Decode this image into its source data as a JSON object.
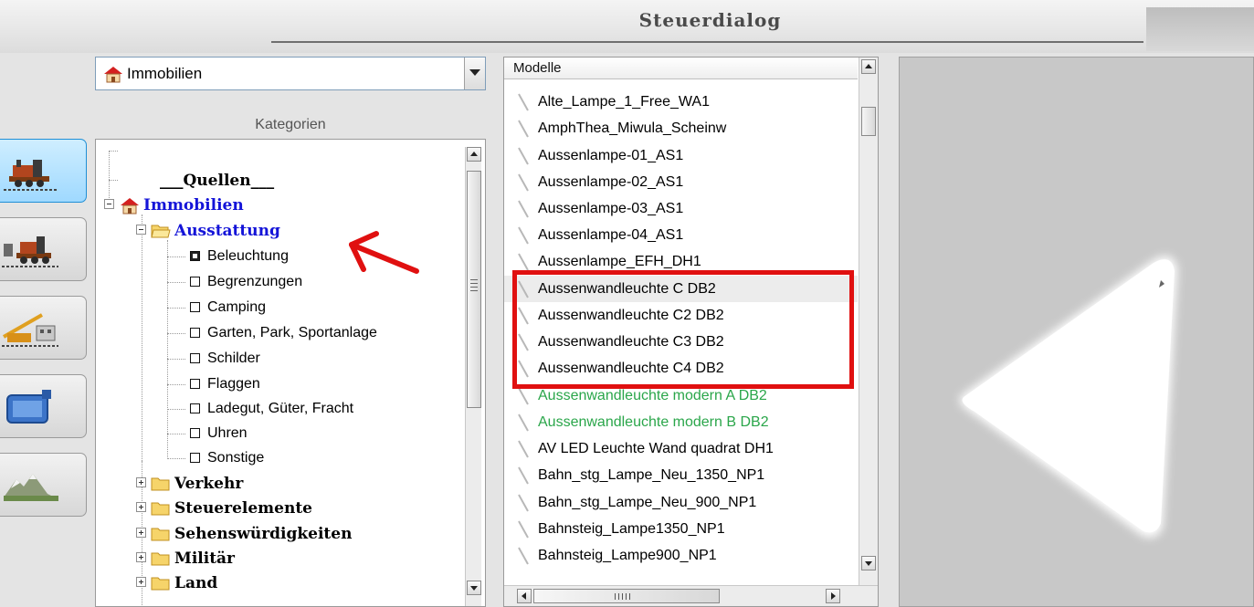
{
  "window": {
    "title": "Steuerdialog"
  },
  "toolbar": {
    "buttons": [
      {
        "icon": "locomotive-icon",
        "active": true
      },
      {
        "icon": "train-set-icon",
        "active": false
      },
      {
        "icon": "crane-icon",
        "active": false
      },
      {
        "icon": "camera-icon",
        "active": false
      },
      {
        "icon": "landscape-icon",
        "active": false
      }
    ]
  },
  "category_select": {
    "value": "Immobilien",
    "icon": "house-icon"
  },
  "categories": {
    "label": "Kategorien",
    "tree": [
      {
        "label": "___Quellen___",
        "style": "bold"
      },
      {
        "label": "Immobilien",
        "style": "bold-blue",
        "expanded": true,
        "icon": "house-icon"
      },
      {
        "label": "Ausstattung",
        "style": "bold-blue",
        "expanded": true,
        "icon": "folder-open-icon"
      },
      {
        "label": "Beleuchtung",
        "style": "plain",
        "checked": true
      },
      {
        "label": "Begrenzungen",
        "style": "plain",
        "checked": false
      },
      {
        "label": "Camping",
        "style": "plain",
        "checked": false
      },
      {
        "label": "Garten, Park, Sportanlage",
        "style": "plain",
        "checked": false
      },
      {
        "label": "Schilder",
        "style": "plain",
        "checked": false
      },
      {
        "label": "Flaggen",
        "style": "plain",
        "checked": false
      },
      {
        "label": "Ladegut, Güter, Fracht",
        "style": "plain",
        "checked": false
      },
      {
        "label": "Uhren",
        "style": "plain",
        "checked": false
      },
      {
        "label": "Sonstige",
        "style": "plain",
        "checked": false
      },
      {
        "label": "Verkehr",
        "style": "bold",
        "expanded": false,
        "icon": "folder-icon"
      },
      {
        "label": "Steuerelemente",
        "style": "bold",
        "expanded": false,
        "icon": "folder-icon"
      },
      {
        "label": "Sehenswürdigkeiten",
        "style": "bold",
        "expanded": false,
        "icon": "folder-icon"
      },
      {
        "label": "Militär",
        "style": "bold",
        "expanded": false,
        "icon": "folder-icon"
      },
      {
        "label": "Land",
        "style": "bold",
        "expanded": false,
        "icon": "folder-icon"
      }
    ]
  },
  "models": {
    "header": "Modelle",
    "items": [
      {
        "label": "Alte_Lampe_1_Free_WA1"
      },
      {
        "label": "AmphThea_Miwula_Scheinw"
      },
      {
        "label": "Aussenlampe-01_AS1"
      },
      {
        "label": "Aussenlampe-02_AS1"
      },
      {
        "label": "Aussenlampe-03_AS1"
      },
      {
        "label": "Aussenlampe-04_AS1"
      },
      {
        "label": "Aussenlampe_EFH_DH1"
      },
      {
        "label": "Aussenwandleuchte C DB2",
        "selected": true
      },
      {
        "label": "Aussenwandleuchte C2 DB2"
      },
      {
        "label": "Aussenwandleuchte C3 DB2"
      },
      {
        "label": "Aussenwandleuchte C4 DB2"
      },
      {
        "label": "Aussenwandleuchte modern A DB2",
        "color": "green"
      },
      {
        "label": "Aussenwandleuchte modern B DB2",
        "color": "green"
      },
      {
        "label": "AV LED Leuchte Wand  quadrat DH1"
      },
      {
        "label": "Bahn_stg_Lampe_Neu_1350_NP1"
      },
      {
        "label": "Bahn_stg_Lampe_Neu_900_NP1"
      },
      {
        "label": "Bahnsteig_Lampe1350_NP1"
      },
      {
        "label": "Bahnsteig_Lampe900_NP1"
      }
    ]
  },
  "annotation": {
    "highlight_color": "#e01010",
    "arrow_color": "#e01010"
  },
  "colors": {
    "active_button": "#9fd9ff",
    "tree_blue": "#1414d8",
    "model_green": "#2aa64a",
    "preview_bg": "#c8c8c8"
  }
}
